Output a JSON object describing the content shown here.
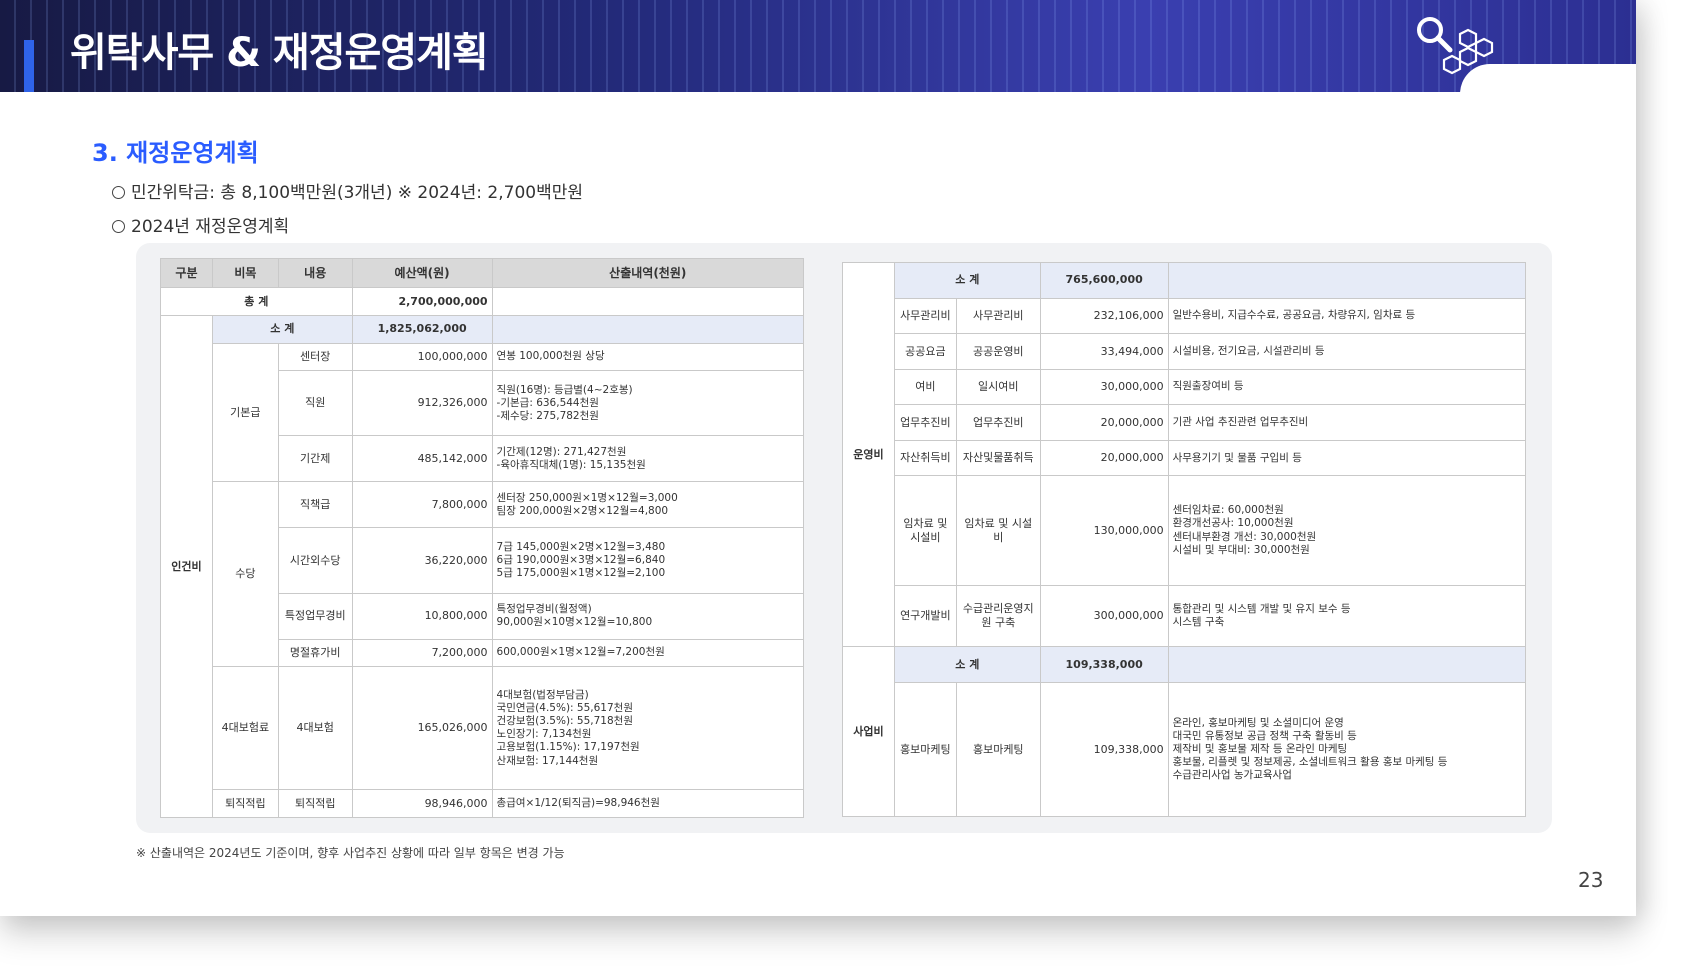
{
  "header": {
    "title": "위탁사무 & 재정운영계획"
  },
  "section": {
    "title": "3. 재정운영계획",
    "bullets": [
      "민간위탁금: 총 8,100백만원(3개년) ※ 2024년: 2,700백만원",
      "2024년 재정운영계획"
    ]
  },
  "left_table": {
    "headers": [
      "구분",
      "비목",
      "내용",
      "예산액(원)",
      "산출내역(천원)"
    ],
    "total_label": "총 계",
    "total_value": "2,700,000,000",
    "personnel": {
      "label": "인건비",
      "subtotal_label": "소 계",
      "subtotal_value": "1,825,062,000",
      "groups": [
        {
          "name": "기본급",
          "rows": [
            {
              "item": "센터장",
              "amount": "100,000,000",
              "desc": "연봉 100,000천원 상당"
            },
            {
              "item": "직원",
              "amount": "912,326,000",
              "desc": "직원(16명): 등급별(4~2호봉)\n-기본급: 636,544천원\n-제수당: 275,782천원"
            },
            {
              "item": "기간제",
              "amount": "485,142,000",
              "desc": "기간제(12명): 271,427천원\n-육아휴직대체(1명): 15,135천원"
            }
          ]
        },
        {
          "name": "수당",
          "rows": [
            {
              "item": "직책급",
              "amount": "7,800,000",
              "desc": "센터장 250,000원×1명×12월=3,000\n팀장 200,000원×2명×12월=4,800"
            },
            {
              "item": "시간외수당",
              "amount": "36,220,000",
              "desc": "7급 145,000원×2명×12월=3,480\n6급 190,000원×3명×12월=6,840\n5급 175,000원×1명×12월=2,100"
            },
            {
              "item": "특정업무경비",
              "amount": "10,800,000",
              "desc": "특정업무경비(월정액)\n90,000원×10명×12월=10,800"
            },
            {
              "item": "명절휴가비",
              "amount": "7,200,000",
              "desc": "600,000원×1명×12월=7,200천원"
            }
          ]
        },
        {
          "name": "4대보험료",
          "rows": [
            {
              "item": "4대보험",
              "amount": "165,026,000",
              "desc": "4대보험(법정부담금)\n국민연금(4.5%): 55,617천원\n건강보험(3.5%): 55,718천원\n노인장기: 7,134천원\n고용보험(1.15%): 17,197천원\n산재보험: 17,144천원"
            }
          ]
        },
        {
          "name": "퇴직적립",
          "rows": [
            {
              "item": "퇴직적립",
              "amount": "98,946,000",
              "desc": "총급여×1/12(퇴직금)=98,946천원"
            }
          ]
        }
      ]
    }
  },
  "right_table": {
    "operating": {
      "label": "운영비",
      "subtotal_label": "소 계",
      "subtotal_value": "765,600,000",
      "rows": [
        {
          "a": "사무관리비",
          "b": "사무관리비",
          "amount": "232,106,000",
          "desc": "일반수용비, 지급수수료, 공공요금, 차량유지, 임차료 등"
        },
        {
          "a": "공공요금",
          "b": "공공운영비",
          "amount": "33,494,000",
          "desc": "시설비용, 전기요금, 시설관리비 등"
        },
        {
          "a": "여비",
          "b": "일시여비",
          "amount": "30,000,000",
          "desc": "직원출장여비 등"
        },
        {
          "a": "업무추진비",
          "b": "업무추진비",
          "amount": "20,000,000",
          "desc": "기관 사업 추진관련 업무추진비"
        },
        {
          "a": "자산취득비",
          "b": "자산및물품취득",
          "amount": "20,000,000",
          "desc": "사무용기기 및 물품 구입비 등"
        },
        {
          "a": "임차료 및 시설비",
          "b": "임차료 및 시설비",
          "amount": "130,000,000",
          "desc": "센터임차료: 60,000천원\n환경개선공사: 10,000천원\n센터내부환경 개선: 30,000천원\n시설비 및 부대비: 30,000천원"
        },
        {
          "a": "연구개발비",
          "b": "수급관리운영지원 구축",
          "amount": "300,000,000",
          "desc": "통합관리 및 시스템 개발 및 유지 보수 등\n시스템 구축"
        }
      ]
    },
    "project": {
      "label": "사업비",
      "subtotal_label": "소 계",
      "subtotal_value": "109,338,000",
      "rows": [
        {
          "a": "홍보마케팅",
          "b": "홍보마케팅",
          "amount": "109,338,000",
          "desc": "온라인, 홍보마케팅 및 소셜미디어 운영\n대국민 유통정보 공급 정책 구축 활동비 등\n제작비 및 홍보물 제작 등 온라인 마케팅\n홍보물, 리플렛 및 정보제공, 소셜네트워크 활용 홍보 마케팅 등\n수급관리사업 농가교육사업"
        }
      ]
    }
  },
  "footnote": "※ 산출내역은 2024년도 기준이며, 향후 사업추진 상황에 따라 일부 항목은 변경 가능",
  "page_number": "23"
}
